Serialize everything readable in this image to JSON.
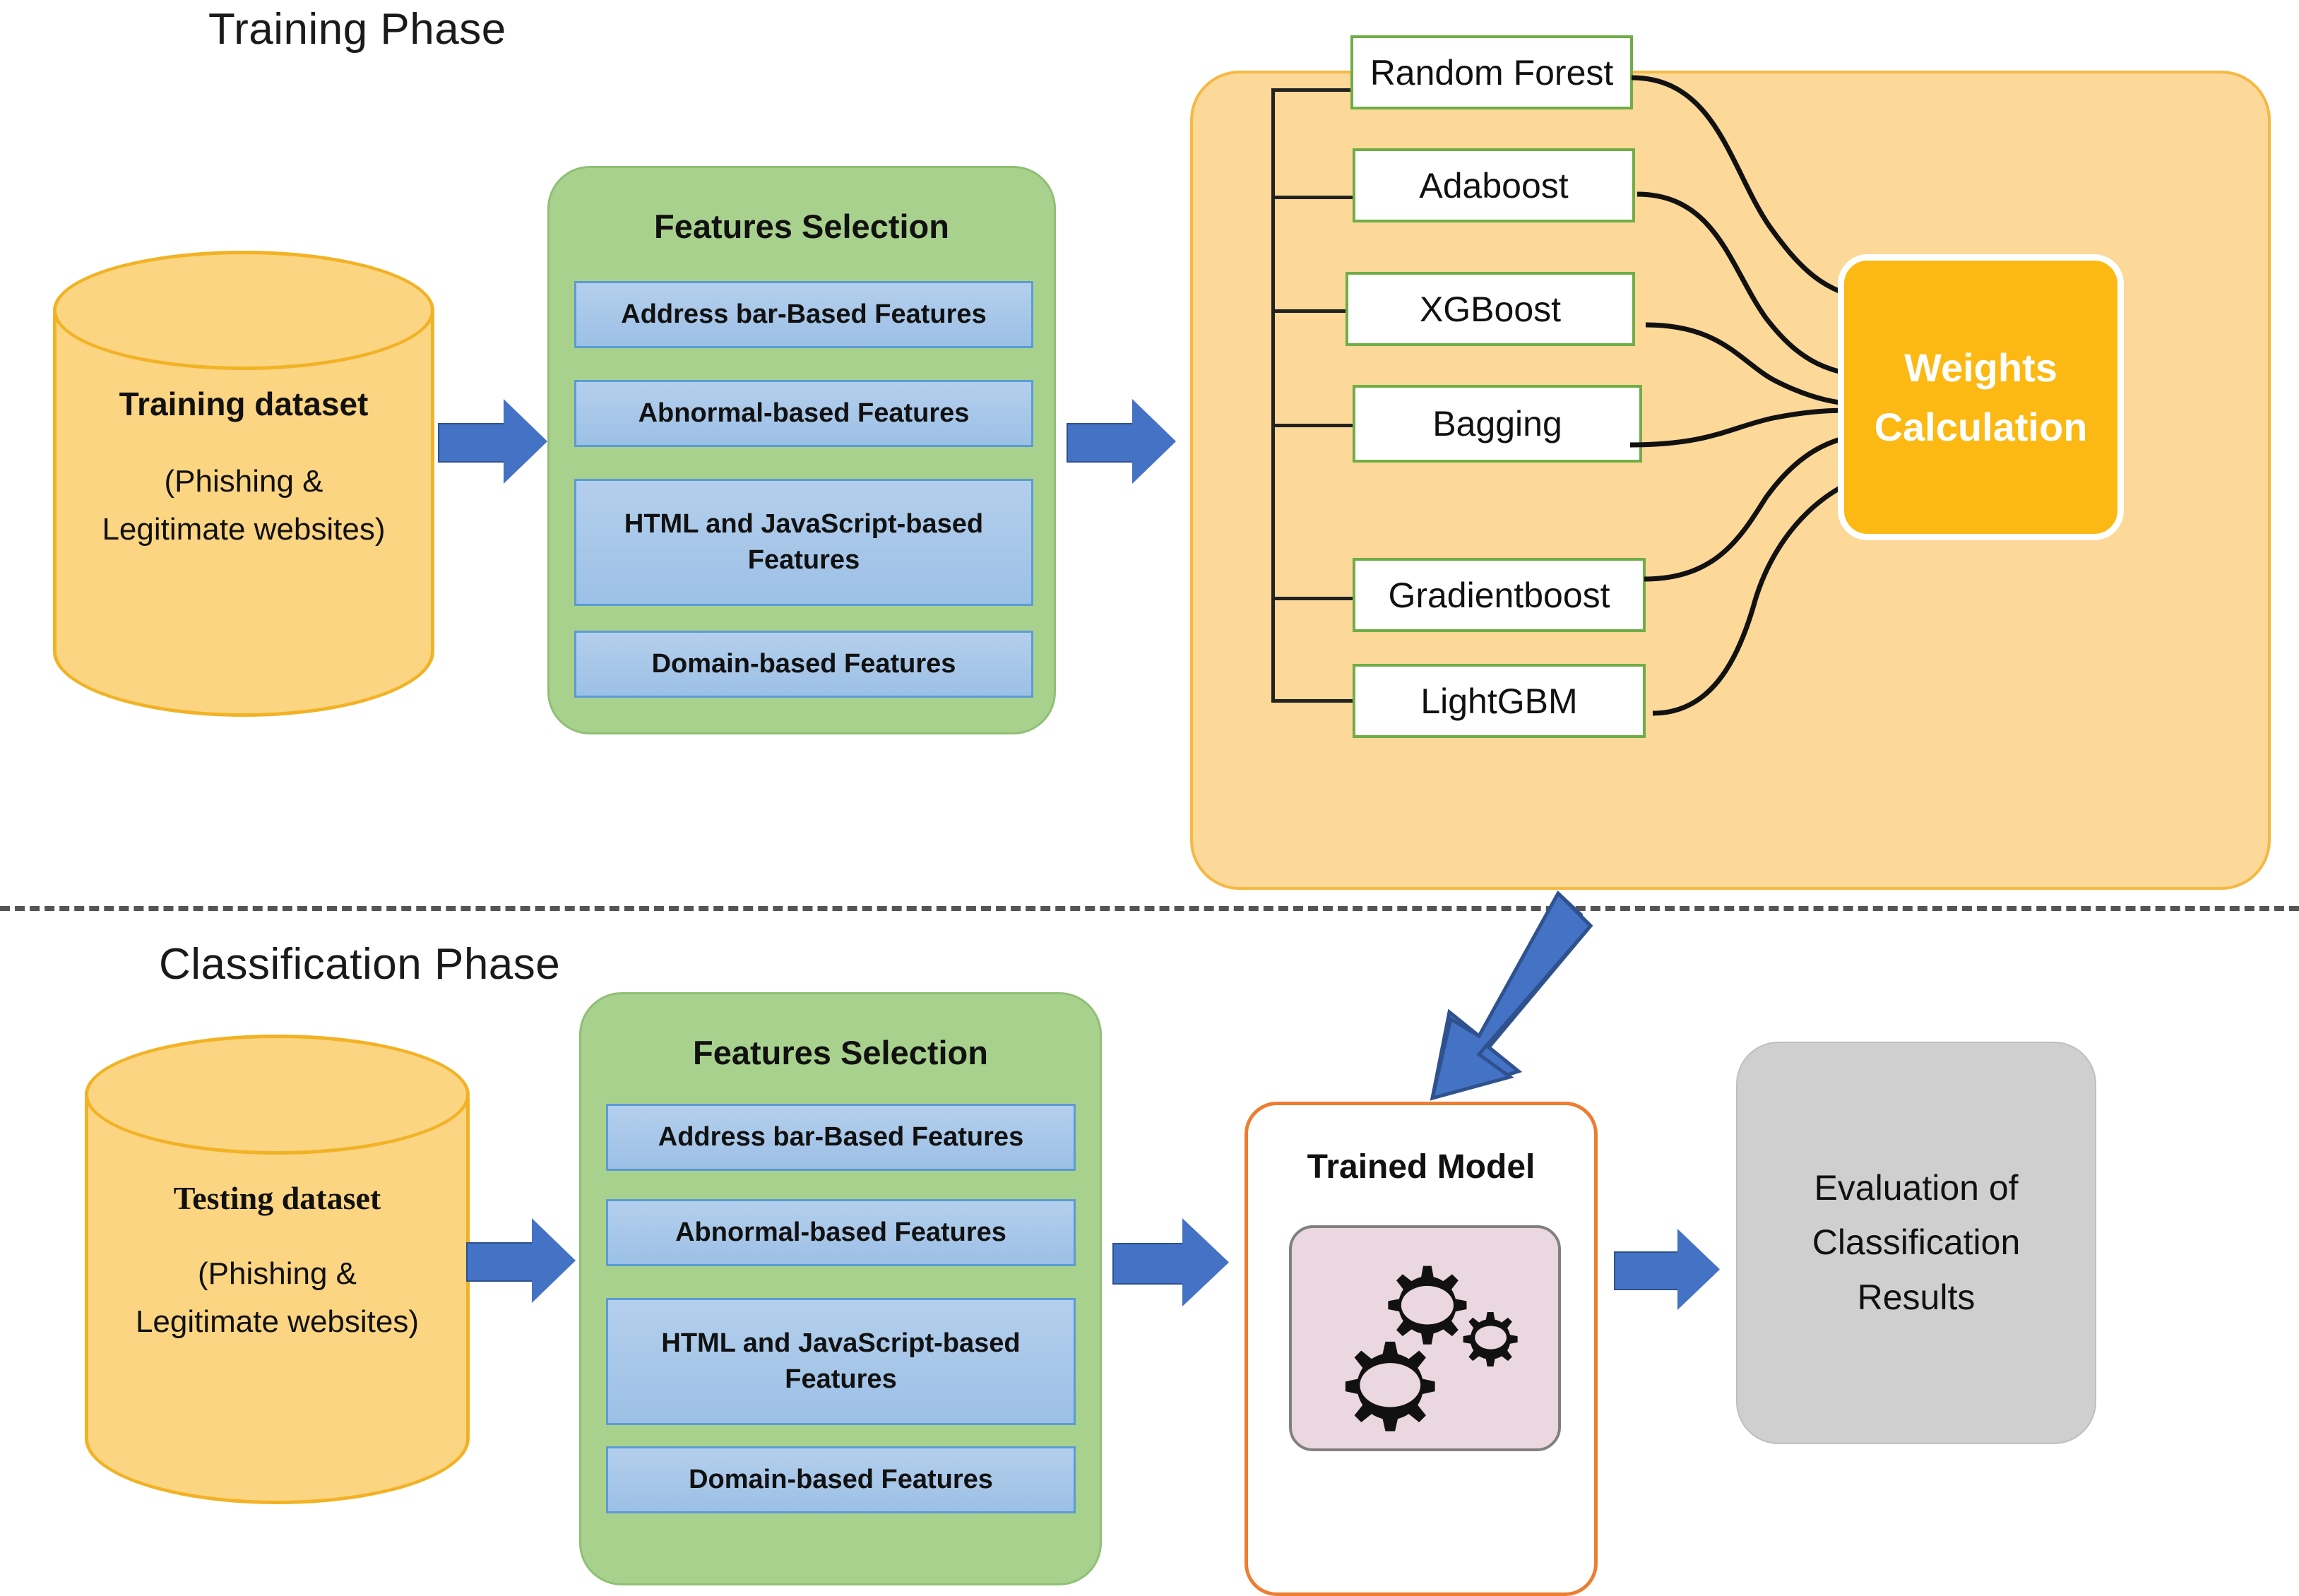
{
  "phases": {
    "training": {
      "title": "Training Phase"
    },
    "classification": {
      "title": "Classification Phase"
    }
  },
  "training": {
    "dataset": {
      "title": "Training dataset",
      "subtitle_line1": "(Phishing &",
      "subtitle_line2": "Legitimate websites)"
    },
    "features_selection": {
      "title": "Features Selection",
      "items": [
        {
          "label": "Address bar-Based Features"
        },
        {
          "label": "Abnormal-based Features"
        },
        {
          "label": "HTML and JavaScript-based Features"
        },
        {
          "label": "Domain-based Features"
        }
      ]
    },
    "ensemble": {
      "classifiers": [
        {
          "label": "Random Forest"
        },
        {
          "label": "Adaboost"
        },
        {
          "label": "XGBoost"
        },
        {
          "label": "Bagging"
        },
        {
          "label": "Gradientboost"
        },
        {
          "label": "LightGBM"
        }
      ],
      "weights": {
        "line1": "Weights",
        "line2": "Calculation"
      }
    }
  },
  "classification": {
    "dataset": {
      "title": "Testing dataset",
      "subtitle_line1": "(Phishing &",
      "subtitle_line2": "Legitimate websites)"
    },
    "features_selection": {
      "title": "Features Selection",
      "items": [
        {
          "label": "Address bar-Based Features"
        },
        {
          "label": "Abnormal-based Features"
        },
        {
          "label": "HTML and JavaScript-based Features"
        },
        {
          "label": "Domain-based Features"
        }
      ]
    },
    "trained_model": {
      "title": "Trained Model",
      "icon": "gears-icon"
    },
    "evaluation": {
      "line1": "Evaluation of",
      "line2": "Classification",
      "line3": "Results"
    }
  },
  "colors": {
    "cylinder_fill": "#fcd582",
    "cylinder_stroke": "#f2b225",
    "green_panel": "#a9d18e",
    "feature_item": "#9cc0e6",
    "feature_item_border": "#5b9bd5",
    "orange_panel": "#fcd899",
    "orange_panel_border": "#f5b942",
    "classifier_border": "#70ad47",
    "weights_fill": "#fcb913",
    "arrow_blue": "#4472c4",
    "trained_model_border": "#ed7d31",
    "gear_panel": "#ead7e0",
    "evaluation_fill": "#cfcfcf",
    "divider": "#555555"
  }
}
